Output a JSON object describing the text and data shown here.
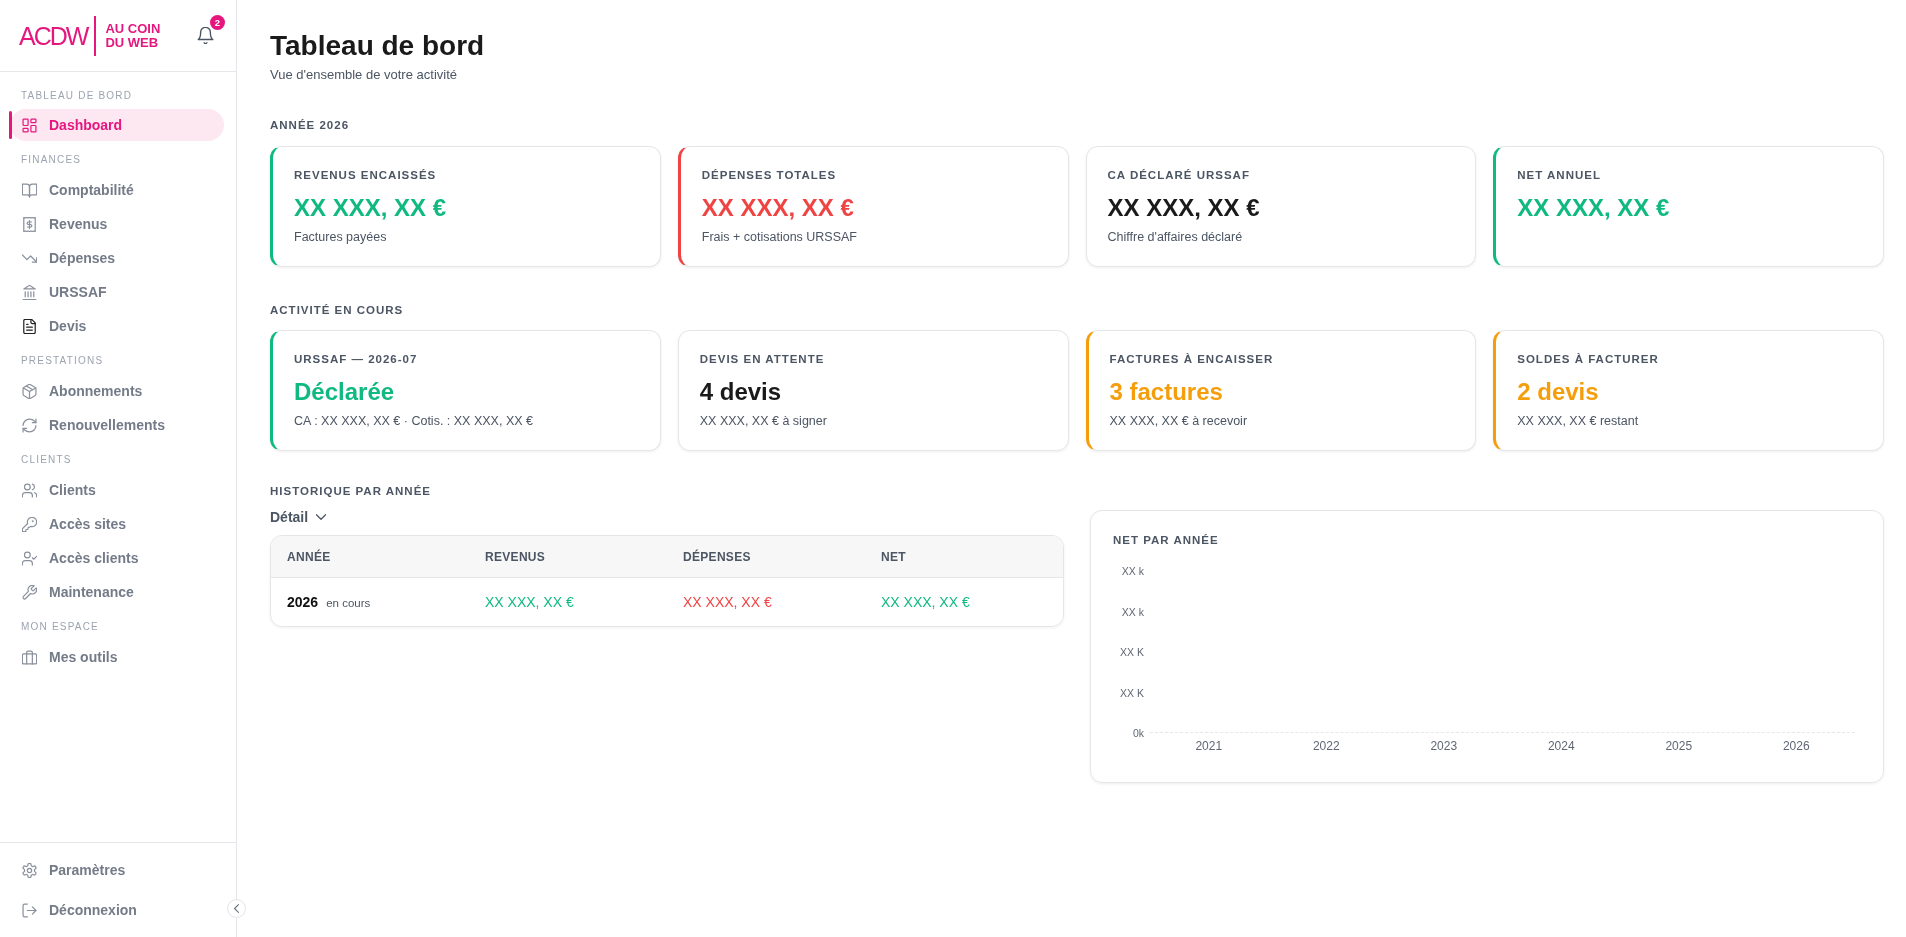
{
  "sidebar": {
    "logo": {
      "mark": "ACDW",
      "lines": [
        "AU COIN",
        "DU WEB"
      ]
    },
    "notifications": {
      "count": "2"
    },
    "sections": [
      {
        "label": "TABLEAU DE BORD",
        "items": [
          {
            "label": "Dashboard",
            "selected": true
          }
        ]
      },
      {
        "label": "FINANCES",
        "items": [
          {
            "label": "Comptabilité",
            "selected": false
          },
          {
            "label": "Revenus",
            "selected": false
          },
          {
            "label": "Dépenses",
            "selected": false
          },
          {
            "label": "URSSAF",
            "selected": false
          },
          {
            "label": "Devis",
            "selected": false
          }
        ]
      },
      {
        "label": "PRESTATIONS",
        "items": [
          {
            "label": "Abonnements",
            "selected": false
          },
          {
            "label": "Renouvellements",
            "selected": false
          }
        ]
      },
      {
        "label": "CLIENTS",
        "items": [
          {
            "label": "Clients",
            "selected": false
          },
          {
            "label": "Accès sites",
            "selected": false
          },
          {
            "label": "Accès clients",
            "selected": false
          },
          {
            "label": "Maintenance",
            "selected": false
          }
        ]
      },
      {
        "label": "MON ESPACE",
        "items": [
          {
            "label": "Mes outils",
            "selected": false
          }
        ]
      }
    ],
    "footer_items": [
      {
        "label": "Paramètres"
      },
      {
        "label": "Déconnexion"
      }
    ]
  },
  "header": {
    "title": "Tableau de bord",
    "subtitle": "Vue d'ensemble de votre activité"
  },
  "stat_sections": [
    {
      "title": "ANNÉE 2026",
      "cards": [
        {
          "label": "REVENUS ENCAISSÉS",
          "value": "XX XXX, XX €",
          "note": "Factures payées",
          "color": "#10b981"
        },
        {
          "label": "DÉPENSES TOTALES",
          "value": "XX XXX, XX €",
          "note": "Frais + cotisations URSSAF",
          "color": "#ef4444"
        },
        {
          "label": "CA DÉCLARÉ URSSAF",
          "value": "XX XXX, XX €",
          "note": "Chiffre d'affaires déclaré"
        },
        {
          "label": "NET ANNUEL",
          "value": "XX XXX, XX €",
          "color": "#10b981"
        }
      ]
    },
    {
      "title": "ACTIVITÉ EN COURS",
      "cards": [
        {
          "label": "URSSAF — 2026-07",
          "value": "Déclarée",
          "note": "CA : XX XXX, XX € · Cotis. : XX XXX, XX €",
          "color": "#10b981"
        },
        {
          "label": "DEVIS EN ATTENTE",
          "value": "4 devis",
          "note": "XX XXX, XX € à signer"
        },
        {
          "label": "FACTURES À ENCAISSER",
          "value": "3 factures",
          "note": "XX XXX, XX € à recevoir",
          "color": "#f59e0b"
        },
        {
          "label": "SOLDES À FACTURER",
          "value": "2 devis",
          "note": "XX XXX, XX € restant",
          "color": "#f59e0b"
        }
      ]
    }
  ],
  "history": {
    "title": "HISTORIQUE PAR ANNÉE",
    "toggle": "Détail",
    "columns": [
      "ANNÉE",
      "REVENUS",
      "DÉPENSES",
      "NET"
    ],
    "rows": [
      {
        "cells": [
          {
            "text": "2026",
            "status": "en cours"
          },
          {
            "text": "XX XXX, XX €",
            "color": "#10b981"
          },
          {
            "text": "XX XXX, XX €",
            "color": "#ef4444"
          },
          {
            "text": "XX XXX, XX €",
            "color": "#10b981"
          }
        ]
      }
    ]
  },
  "chart": {
    "title": "NET PAR ANNÉE",
    "y_labels": [
      "XX k",
      "XX k",
      "XX K",
      "XX K",
      "0k"
    ],
    "x_labels": [
      "2021",
      "2022",
      "2023",
      "2024",
      "2025",
      "2026"
    ]
  }
}
